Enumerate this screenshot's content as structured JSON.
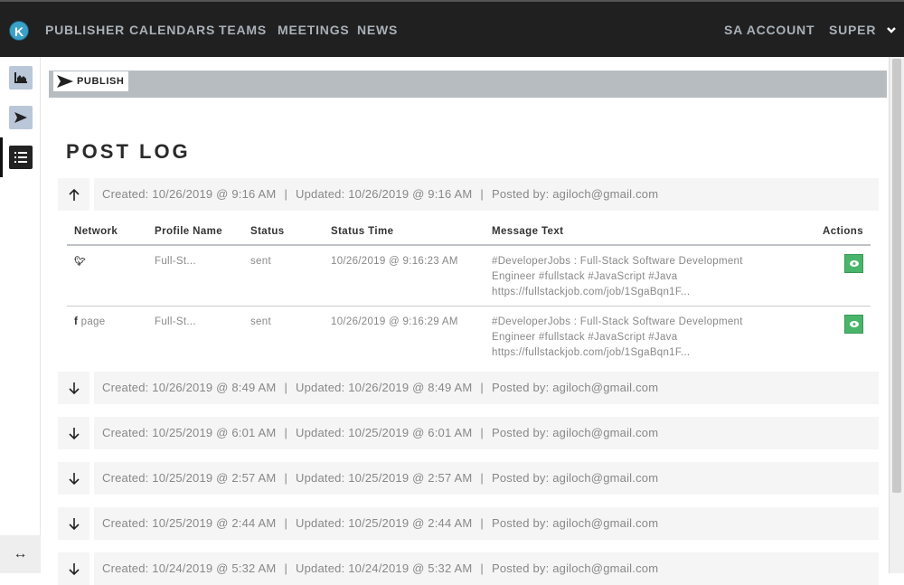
{
  "nav": {
    "logo": "K",
    "items": [
      "PUBLISHER",
      "CALENDARS",
      "TEAMS",
      "MEETINGS",
      "NEWS"
    ],
    "account": "SA ACCOUNT",
    "user": "SUPER"
  },
  "toolbar": {
    "publish_label": "PUBLISH"
  },
  "page_title": "POST LOG",
  "table": {
    "headers": [
      "Network",
      "Profile Name",
      "Status",
      "Status Time",
      "Message Text",
      "Actions"
    ],
    "rows": [
      {
        "network": "",
        "network_icon": "twitter-icon",
        "profile": "Full-St...",
        "status": "sent",
        "time": "10/26/2019 @ 9:16:23 AM",
        "message": [
          "#DeveloperJobs : Full-Stack Software Development",
          "Engineer #fullstack #JavaScript #Java",
          "https://fullstackjob.com/job/1SgaBqn1F..."
        ]
      },
      {
        "network": "page",
        "network_icon": "facebook-icon",
        "profile": "Full-St...",
        "status": "sent",
        "time": "10/26/2019 @ 9:16:29 AM",
        "message": [
          "#DeveloperJobs : Full-Stack Software Development",
          "Engineer #fullstack #JavaScript #Java",
          "https://fullstackjob.com/job/1SgaBqn1F..."
        ]
      }
    ]
  },
  "logs": [
    {
      "expanded": true,
      "created": "Created: 10/26/2019 @ 9:16 AM",
      "updated": "Updated: 10/26/2019 @ 9:16 AM",
      "posted": "Posted by: agiloch@gmail.com"
    },
    {
      "expanded": false,
      "created": "Created: 10/26/2019 @ 8:49 AM",
      "updated": "Updated: 10/26/2019 @ 8:49 AM",
      "posted": "Posted by: agiloch@gmail.com"
    },
    {
      "expanded": false,
      "created": "Created: 10/25/2019 @ 6:01 AM",
      "updated": "Updated: 10/25/2019 @ 6:01 AM",
      "posted": "Posted by: agiloch@gmail.com"
    },
    {
      "expanded": false,
      "created": "Created: 10/25/2019 @ 2:57 AM",
      "updated": "Updated: 10/25/2019 @ 2:57 AM",
      "posted": "Posted by: agiloch@gmail.com"
    },
    {
      "expanded": false,
      "created": "Created: 10/25/2019 @ 2:44 AM",
      "updated": "Updated: 10/25/2019 @ 2:44 AM",
      "posted": "Posted by: agiloch@gmail.com"
    },
    {
      "expanded": false,
      "created": "Created: 10/24/2019 @ 5:32 AM",
      "updated": "Updated: 10/24/2019 @ 5:32 AM",
      "posted": "Posted by: agiloch@gmail.com"
    }
  ],
  "separator": "|"
}
